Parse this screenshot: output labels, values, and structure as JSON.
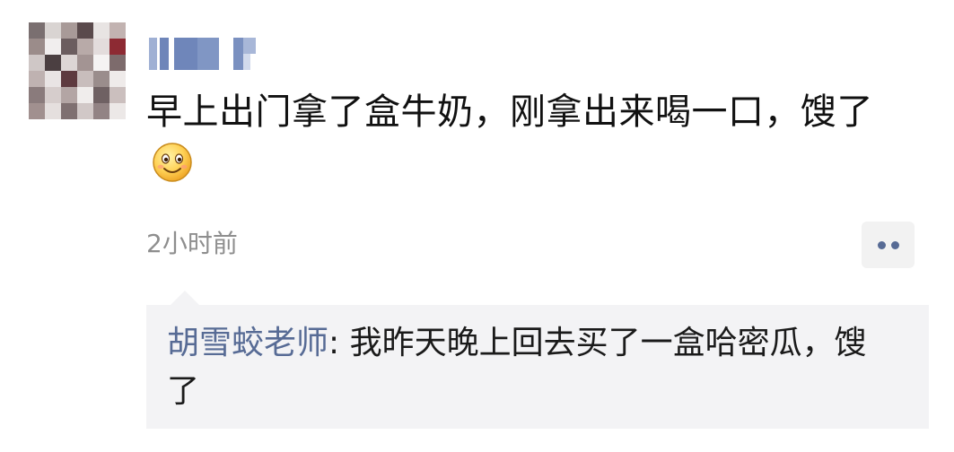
{
  "post": {
    "avatar_icon": "user-avatar-icon",
    "author_name_obscured": true,
    "text": "早上出门拿了盒牛奶，刚拿出来喝一口，馊了",
    "emoji": "smile-emoji-icon",
    "timestamp": "2小时前",
    "more_icon": "more-dots-icon"
  },
  "comments": [
    {
      "author": "胡雪蛟老师",
      "separator": ": ",
      "text": "我昨天晚上回去买了一盒哈密瓜，馊了"
    }
  ],
  "colors": {
    "link": "#576b95",
    "timestamp": "#8e8e8e",
    "comment_bg": "#f3f3f5",
    "text": "#111111"
  }
}
